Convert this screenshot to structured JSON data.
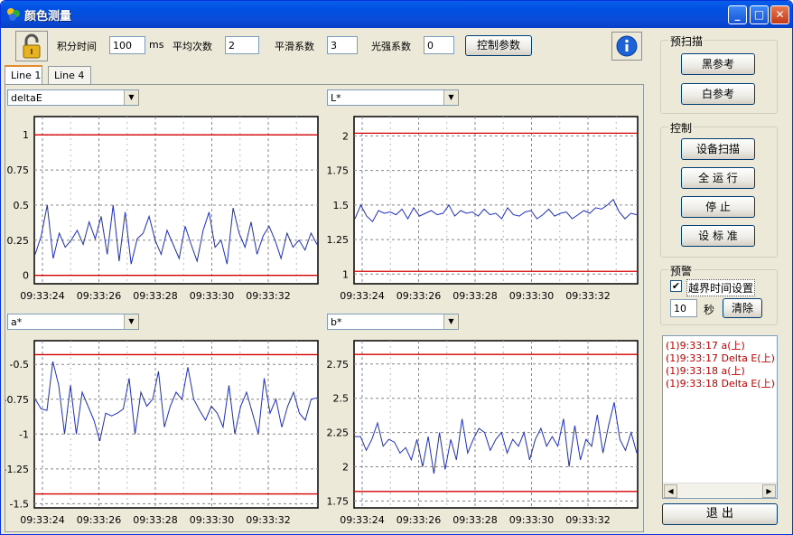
{
  "window": {
    "title": "颜色测量",
    "buttons": {
      "minimize": "_",
      "maximize": "□",
      "close": "✕"
    }
  },
  "toolbar": {
    "integration_label": "积分时间",
    "integration_value": "100",
    "integration_unit": "ms",
    "average_label": "平均次数",
    "average_value": "2",
    "smooth_label": "平滑系数",
    "smooth_value": "3",
    "light_label": "光强系数",
    "light_value": "0",
    "control_params_button": "控制参数"
  },
  "tabs": [
    {
      "label": "Line 1",
      "active": true
    },
    {
      "label": "Line 4",
      "active": false
    }
  ],
  "charts": [
    {
      "selector": "deltaE",
      "yticks": [
        "1",
        "0.75",
        "0.5",
        "0.25",
        "0"
      ]
    },
    {
      "selector": "L*",
      "yticks": [
        "2",
        "1.75",
        "1.5",
        "1.25",
        "1"
      ]
    },
    {
      "selector": "a*",
      "yticks": [
        "-0.5",
        "-0.75",
        "-1",
        "-1.25",
        "-1.5"
      ]
    },
    {
      "selector": "b*",
      "yticks": [
        "2.75",
        "2.5",
        "2.25",
        "2",
        "1.75"
      ]
    }
  ],
  "chart_data": [
    {
      "type": "line",
      "ylim": [
        -0.06,
        1.13
      ],
      "x": [
        "09:33:24",
        "09:33:26",
        "09:33:28",
        "09:33:30",
        "09:33:32"
      ],
      "limits": [
        1.0,
        0.0
      ],
      "series": [
        {
          "values": [
            0.15,
            0.28,
            0.5,
            0.12,
            0.3,
            0.2,
            0.25,
            0.32,
            0.22,
            0.38,
            0.26,
            0.42,
            0.15,
            0.5,
            0.1,
            0.45,
            0.08,
            0.26,
            0.3,
            0.42,
            0.25,
            0.15,
            0.32,
            0.22,
            0.12,
            0.35,
            0.22,
            0.1,
            0.32,
            0.45,
            0.2,
            0.25,
            0.08,
            0.48,
            0.3,
            0.2,
            0.38,
            0.15,
            0.28,
            0.35,
            0.25,
            0.12,
            0.3,
            0.2,
            0.25,
            0.18,
            0.3,
            0.22
          ]
        }
      ]
    },
    {
      "type": "line",
      "ylim": [
        0.93,
        2.14
      ],
      "x": [
        "09:33:24",
        "09:33:26",
        "09:33:28",
        "09:33:30",
        "09:33:32"
      ],
      "limits": [
        2.02,
        1.02
      ],
      "series": [
        {
          "values": [
            1.4,
            1.5,
            1.42,
            1.38,
            1.46,
            1.44,
            1.45,
            1.43,
            1.47,
            1.4,
            1.48,
            1.42,
            1.44,
            1.46,
            1.43,
            1.44,
            1.5,
            1.42,
            1.46,
            1.44,
            1.45,
            1.42,
            1.47,
            1.43,
            1.44,
            1.4,
            1.48,
            1.43,
            1.42,
            1.45,
            1.46,
            1.4,
            1.43,
            1.47,
            1.42,
            1.44,
            1.45,
            1.4,
            1.43,
            1.46,
            1.44,
            1.48,
            1.47,
            1.5,
            1.54,
            1.45,
            1.4,
            1.44,
            1.43
          ]
        }
      ]
    },
    {
      "type": "line",
      "ylim": [
        -1.53,
        -0.33
      ],
      "x": [
        "09:33:24",
        "09:33:26",
        "09:33:28",
        "09:33:30",
        "09:33:32"
      ],
      "limits": [
        -0.43,
        -1.43
      ],
      "series": [
        {
          "values": [
            -0.75,
            -0.82,
            -0.83,
            -0.48,
            -0.65,
            -1.0,
            -0.65,
            -1.0,
            -0.7,
            -0.8,
            -0.9,
            -1.05,
            -0.85,
            -0.87,
            -0.85,
            -0.82,
            -0.6,
            -1.0,
            -0.7,
            -0.8,
            -0.75,
            -0.55,
            -0.95,
            -0.8,
            -0.7,
            -0.75,
            -0.52,
            -0.75,
            -0.83,
            -0.9,
            -0.8,
            -0.85,
            -0.95,
            -0.65,
            -1.0,
            -0.8,
            -0.7,
            -0.85,
            -1.0,
            -0.6,
            -0.85,
            -0.75,
            -0.95,
            -0.8,
            -0.7,
            -0.85,
            -0.9,
            -0.75,
            -0.74
          ]
        }
      ]
    },
    {
      "type": "line",
      "ylim": [
        1.7,
        2.92
      ],
      "x": [
        "09:33:24",
        "09:33:26",
        "09:33:28",
        "09:33:30",
        "09:33:32"
      ],
      "limits": [
        2.82,
        1.82
      ],
      "series": [
        {
          "values": [
            2.22,
            2.22,
            2.12,
            2.2,
            2.32,
            2.15,
            2.2,
            2.18,
            2.1,
            2.14,
            2.05,
            2.2,
            2.0,
            2.22,
            1.95,
            2.25,
            1.98,
            2.2,
            2.05,
            2.35,
            2.1,
            2.2,
            2.28,
            2.25,
            2.12,
            2.2,
            2.25,
            2.1,
            2.2,
            2.15,
            2.25,
            2.05,
            2.2,
            2.28,
            2.15,
            2.22,
            2.15,
            2.35,
            2.0,
            2.3,
            2.05,
            2.2,
            2.15,
            2.38,
            2.1,
            2.3,
            2.47,
            2.2,
            2.12,
            2.25,
            2.1
          ]
        }
      ]
    }
  ],
  "sidebar": {
    "prescan_title": "预扫描",
    "black_ref_button": "黑参考",
    "white_ref_button": "白参考",
    "control_title": "控制",
    "device_scan_button": "设备扫描",
    "run_all_button": "全 运 行",
    "stop_button": "停 止",
    "set_standard_button": "设 标 准",
    "alarm_title": "预警",
    "threshold_time_checkbox": "越界时间设置",
    "threshold_time_checked": "✔",
    "threshold_seconds_value": "10",
    "seconds_unit": "秒",
    "clear_button": "清除",
    "log_entries": [
      "(1)9:33:17 a(上)",
      "(1)9:33:17 Delta E(上)",
      "(1)9:33:18 a(上)",
      "(1)9:33:18 Delta E(上)"
    ],
    "exit_button": "退 出"
  },
  "colors": {
    "series": "#1f2fc0",
    "limit": "#d40000",
    "grid": "#888888",
    "log_text": "#c00000"
  }
}
